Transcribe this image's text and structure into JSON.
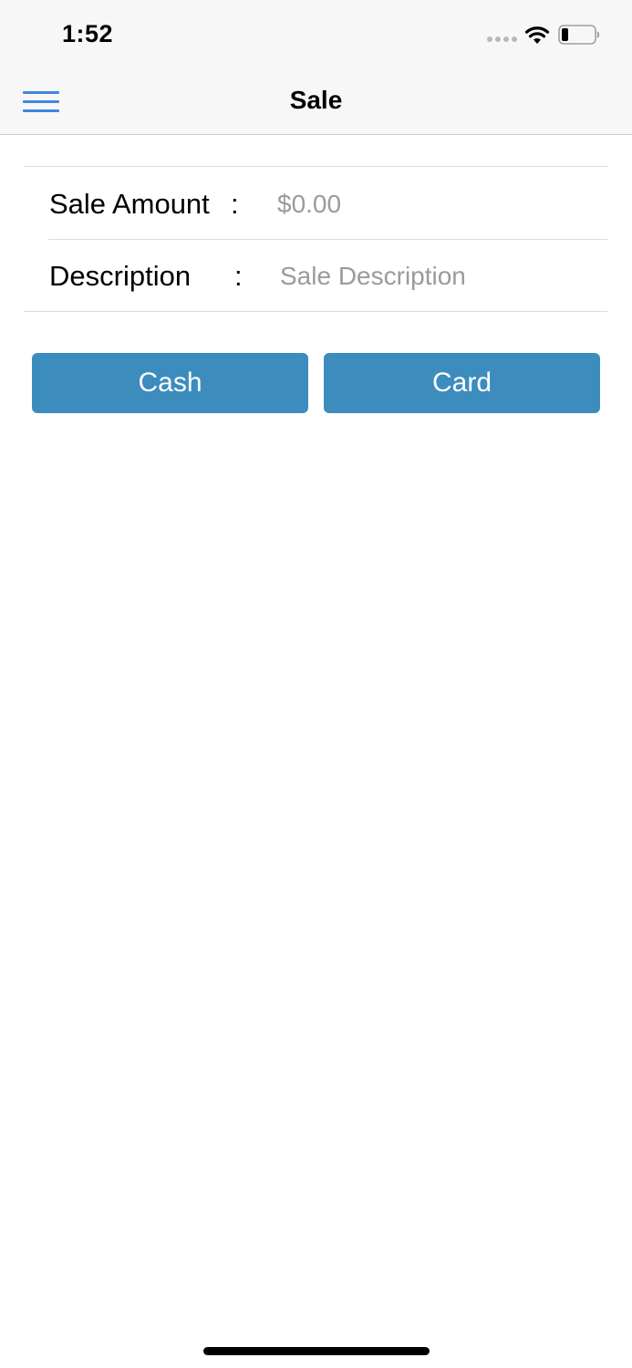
{
  "status_bar": {
    "time": "1:52",
    "icons": [
      "cellular-signal-icon",
      "wifi-icon",
      "battery-icon"
    ]
  },
  "nav": {
    "title": "Sale",
    "menu_icon": "hamburger-menu-icon"
  },
  "form": {
    "sale_amount": {
      "label": "Sale Amount",
      "separator": ":",
      "placeholder": "$0.00",
      "value": ""
    },
    "description": {
      "label": "Description",
      "separator": ":",
      "placeholder": "Sale Description",
      "value": ""
    }
  },
  "buttons": {
    "cash": "Cash",
    "card": "Card"
  },
  "colors": {
    "accent": "#3f87e0",
    "button": "#3c8cbe",
    "placeholder": "#9a9a9f",
    "bar_background": "#f7f7f7"
  }
}
